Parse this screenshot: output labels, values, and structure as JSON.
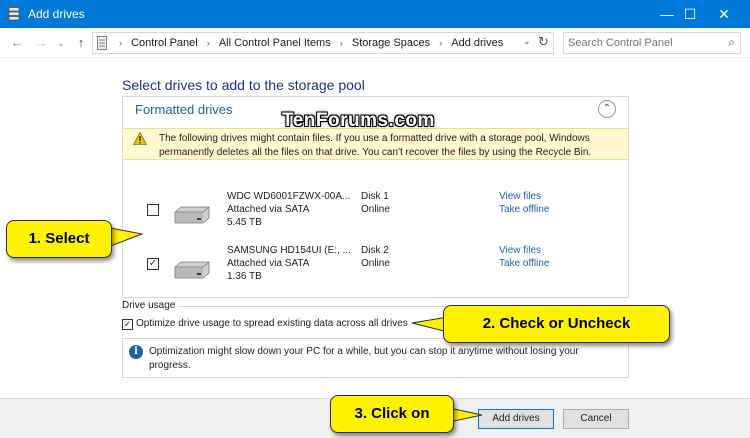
{
  "window": {
    "title": "Add drives",
    "controls": {
      "minimize": "—",
      "maximize": "☐",
      "close": "✕"
    }
  },
  "navigation": {
    "back": "←",
    "forward": "→",
    "recent": "⌄",
    "up": "↑",
    "breadcrumbs": [
      "Control Panel",
      "All Control Panel Items",
      "Storage Spaces",
      "Add drives"
    ],
    "breadcrumb_separator": "›",
    "dropdown": "⌄",
    "refresh": "↻",
    "search_placeholder": "Search Control Panel",
    "search_icon": "⌕"
  },
  "content": {
    "heading": "Select drives to add to the storage pool",
    "panel_title": "Formatted drives",
    "collapse_glyph": "⌃",
    "warning": "The following drives might contain files. If you use a formatted drive with a storage pool, Windows permanently deletes all the files on that drive. You can't recover the files by using the Recycle Bin.",
    "drives": [
      {
        "name": "WDC WD6001FZWX-00A...",
        "connection": "Attached via SATA",
        "size": "5.45 TB",
        "disk": "Disk 1",
        "status": "Online",
        "link1": "View files",
        "link2": "Take offline",
        "checked": false,
        "check_glyph": ""
      },
      {
        "name": "SAMSUNG HD154UI (E:, ...",
        "connection": "Attached via SATA",
        "size": "1.36 TB",
        "disk": "Disk 2",
        "status": "Online",
        "link1": "View files",
        "link2": "Take offline",
        "checked": true,
        "check_glyph": "✓"
      }
    ],
    "drive_usage_label": "Drive usage",
    "optimize_label": "Optimize drive usage to spread existing data across all drives",
    "optimize_checked": true,
    "optimize_check_glyph": "✓",
    "info_icon": "i",
    "info_text": "Optimization might slow down your PC for a while, but you can stop it anytime without losing your progress."
  },
  "footer": {
    "add_button": "Add drives",
    "cancel_button": "Cancel"
  },
  "callouts": {
    "select": "1. Select",
    "check": "2. Check or Uncheck",
    "click": "3. Click on"
  },
  "watermark": "TenForums.com",
  "colors": {
    "titlebar": "#0078d7",
    "heading": "#1e3287",
    "link": "#1e60ab",
    "warning_bg": "#fff8d0",
    "callout": "#fff200"
  }
}
